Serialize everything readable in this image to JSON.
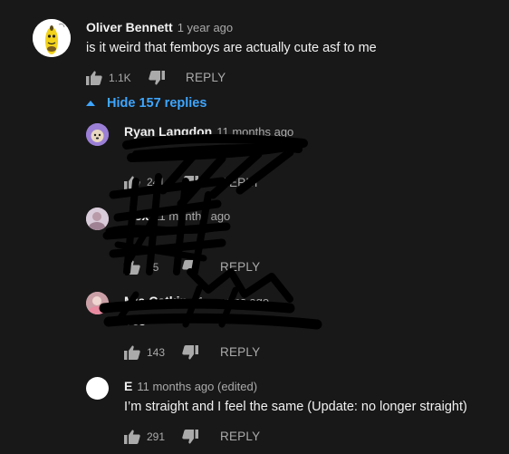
{
  "comment": {
    "author": "Oliver Bennett",
    "time": "1 year ago",
    "text": "is it weird that femboys are actually cute asf to me",
    "likes": "1.1K",
    "reply_label": "REPLY",
    "hide_replies_label": "Hide 157 replies"
  },
  "replies": [
    {
      "author": "Ryan Langdon",
      "time": "11 months ago",
      "text": "",
      "likes": "241",
      "reply_label": "REPLY"
    },
    {
      "author": "alex",
      "time": "11 months ago",
      "text": "",
      "likes": "55",
      "reply_label": "REPLY"
    },
    {
      "author": "Mia Catkin",
      "time": "11 months ago",
      "text": "Yes",
      "likes": "143",
      "reply_label": "REPLY"
    },
    {
      "author": "E",
      "time": "11 months ago (edited)",
      "text": "I’m straight and I feel the same (Update: no longer straight)",
      "likes": "291",
      "reply_label": "REPLY"
    }
  ],
  "colors": {
    "background": "#181818",
    "text": "#f1f1f1",
    "secondary": "#aaaaaa",
    "link": "#3ea6ff",
    "scribble": "#000000"
  },
  "icons": {
    "like": "thumb-up-icon",
    "dislike": "thumb-down-icon",
    "collapse": "caret-up-icon"
  }
}
